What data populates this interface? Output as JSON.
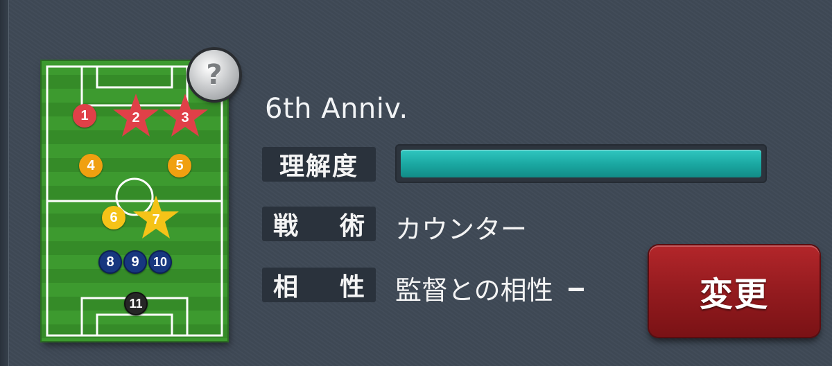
{
  "help": {
    "label": "?"
  },
  "formation": {
    "name": "6th Anniv.",
    "players": [
      {
        "num": "1",
        "role": "red"
      },
      {
        "num": "2",
        "role": "red-star"
      },
      {
        "num": "3",
        "role": "red-star"
      },
      {
        "num": "4",
        "role": "orange"
      },
      {
        "num": "5",
        "role": "orange"
      },
      {
        "num": "6",
        "role": "yellow"
      },
      {
        "num": "7",
        "role": "yellow-star"
      },
      {
        "num": "8",
        "role": "blue"
      },
      {
        "num": "9",
        "role": "blue"
      },
      {
        "num": "10",
        "role": "blue"
      },
      {
        "num": "11",
        "role": "black"
      }
    ]
  },
  "stats": {
    "understanding_label": "理解度",
    "understanding_level": 1.0,
    "tactics_label_1": "戦",
    "tactics_label_2": "術",
    "tactics_value": "カウンター",
    "compat_label_1": "相",
    "compat_label_2": "性",
    "compat_value": "監督との相性"
  },
  "change_button": {
    "label": "変更"
  },
  "colors": {
    "bar": "#1aa6a0",
    "button": "#941b1f",
    "red_player": "#e04048",
    "orange_player": "#f0a010",
    "yellow_player": "#f5c318",
    "blue_player": "#17377f"
  }
}
